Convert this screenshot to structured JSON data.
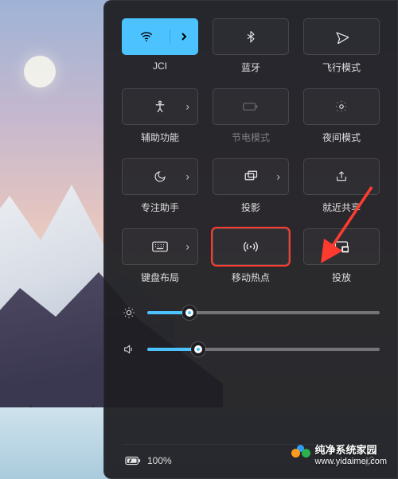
{
  "tiles": [
    {
      "id": "wifi",
      "label": "JCI",
      "icon": "wifi-icon",
      "active": true,
      "split": true
    },
    {
      "id": "bluetooth",
      "label": "蓝牙",
      "icon": "bluetooth-icon",
      "active": false
    },
    {
      "id": "airplane",
      "label": "飞行模式",
      "icon": "airplane-icon",
      "active": false
    },
    {
      "id": "accessibility",
      "label": "辅助功能",
      "icon": "accessibility-icon",
      "expandable": true
    },
    {
      "id": "battery-saver",
      "label": "节电模式",
      "icon": "battery-icon",
      "disabled": true,
      "dim": true
    },
    {
      "id": "night-light",
      "label": "夜间模式",
      "icon": "night-light-icon"
    },
    {
      "id": "focus",
      "label": "专注助手",
      "icon": "moon-icon",
      "expandable": true
    },
    {
      "id": "project",
      "label": "投影",
      "icon": "project-icon",
      "expandable": true
    },
    {
      "id": "nearby",
      "label": "就近共享",
      "icon": "share-icon"
    },
    {
      "id": "keyboard",
      "label": "键盘布局",
      "icon": "keyboard-icon",
      "expandable": true
    },
    {
      "id": "hotspot",
      "label": "移动热点",
      "icon": "hotspot-icon",
      "highlight": true
    },
    {
      "id": "cast",
      "label": "投放",
      "icon": "cast-icon"
    }
  ],
  "sliders": {
    "brightness": 18,
    "volume": 22
  },
  "status": {
    "battery_text": "100%"
  },
  "watermark": {
    "title": "纯净系统家园",
    "url": "www.yidaimei.com"
  }
}
